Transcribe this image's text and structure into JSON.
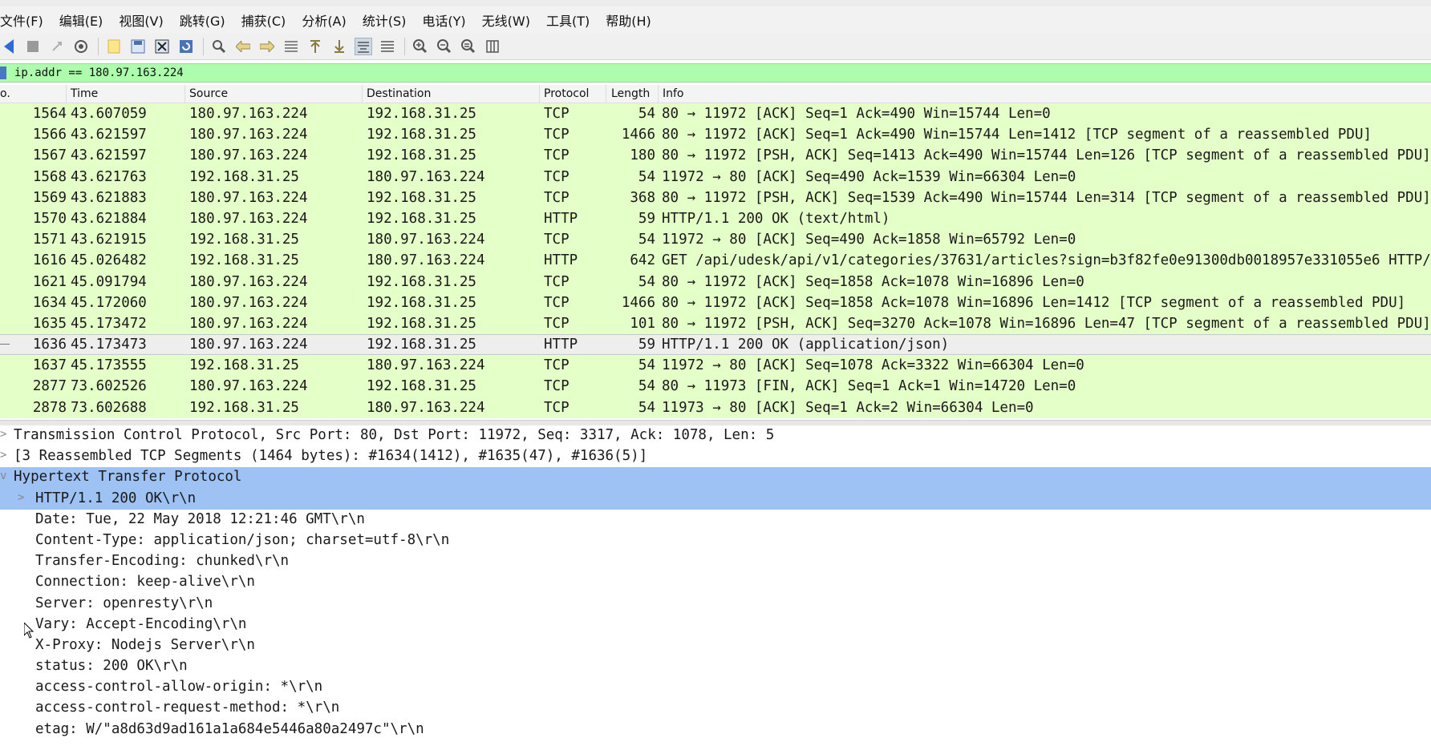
{
  "menubar": {
    "items": [
      {
        "label": "文件(F)"
      },
      {
        "label": "编辑(E)"
      },
      {
        "label": "视图(V)"
      },
      {
        "label": "跳转(G)"
      },
      {
        "label": "捕获(C)"
      },
      {
        "label": "分析(A)"
      },
      {
        "label": "统计(S)"
      },
      {
        "label": "电话(Y)"
      },
      {
        "label": "无线(W)"
      },
      {
        "label": "工具(T)"
      },
      {
        "label": "帮助(H)"
      }
    ]
  },
  "toolbar": {
    "icons": [
      "start-capture-icon",
      "stop-capture-icon",
      "restart-capture-icon",
      "capture-options-icon",
      "open-file-icon",
      "save-file-icon",
      "close-file-icon",
      "reload-file-icon",
      "find-packet-icon",
      "go-back-icon",
      "go-forward-icon",
      "go-to-packet-icon",
      "go-first-icon",
      "go-last-icon",
      "autoscroll-icon",
      "colorize-icon",
      "zoom-in-icon",
      "zoom-out-icon",
      "zoom-normal-icon",
      "resize-columns-icon"
    ]
  },
  "filter": {
    "value": "ip.addr == 180.97.163.224",
    "color": "#aefcae"
  },
  "packet_list": {
    "headers": {
      "no": "o.",
      "time": "Time",
      "source": "Source",
      "destination": "Destination",
      "protocol": "Protocol",
      "length": "Length",
      "info": "Info"
    },
    "row_color": "#e4ffc7",
    "rows": [
      {
        "no": "1564",
        "time": "43.607059",
        "src": "180.97.163.224",
        "dst": "192.168.31.25",
        "proto": "TCP",
        "len": "54",
        "info": "80 → 11972 [ACK] Seq=1 Ack=490 Win=15744 Len=0"
      },
      {
        "no": "1566",
        "time": "43.621597",
        "src": "180.97.163.224",
        "dst": "192.168.31.25",
        "proto": "TCP",
        "len": "1466",
        "info": "80 → 11972 [ACK] Seq=1 Ack=490 Win=15744 Len=1412 [TCP segment of a reassembled PDU]"
      },
      {
        "no": "1567",
        "time": "43.621597",
        "src": "180.97.163.224",
        "dst": "192.168.31.25",
        "proto": "TCP",
        "len": "180",
        "info": "80 → 11972 [PSH, ACK] Seq=1413 Ack=490 Win=15744 Len=126 [TCP segment of a reassembled PDU]"
      },
      {
        "no": "1568",
        "time": "43.621763",
        "src": "192.168.31.25",
        "dst": "180.97.163.224",
        "proto": "TCP",
        "len": "54",
        "info": "11972 → 80 [ACK] Seq=490 Ack=1539 Win=66304 Len=0"
      },
      {
        "no": "1569",
        "time": "43.621883",
        "src": "180.97.163.224",
        "dst": "192.168.31.25",
        "proto": "TCP",
        "len": "368",
        "info": "80 → 11972 [PSH, ACK] Seq=1539 Ack=490 Win=15744 Len=314 [TCP segment of a reassembled PDU]"
      },
      {
        "no": "1570",
        "time": "43.621884",
        "src": "180.97.163.224",
        "dst": "192.168.31.25",
        "proto": "HTTP",
        "len": "59",
        "info": "HTTP/1.1 200 OK  (text/html)"
      },
      {
        "no": "1571",
        "time": "43.621915",
        "src": "192.168.31.25",
        "dst": "180.97.163.224",
        "proto": "TCP",
        "len": "54",
        "info": "11972 → 80 [ACK] Seq=490 Ack=1858 Win=65792 Len=0"
      },
      {
        "no": "1616",
        "time": "45.026482",
        "src": "192.168.31.25",
        "dst": "180.97.163.224",
        "proto": "HTTP",
        "len": "642",
        "info": "GET /api/udesk/api/v1/categories/37631/articles?sign=b3f82fe0e91300db0018957e331055e6 HTTP/"
      },
      {
        "no": "1621",
        "time": "45.091794",
        "src": "180.97.163.224",
        "dst": "192.168.31.25",
        "proto": "TCP",
        "len": "54",
        "info": "80 → 11972 [ACK] Seq=1858 Ack=1078 Win=16896 Len=0"
      },
      {
        "no": "1634",
        "time": "45.172060",
        "src": "180.97.163.224",
        "dst": "192.168.31.25",
        "proto": "TCP",
        "len": "1466",
        "info": "80 → 11972 [ACK] Seq=1858 Ack=1078 Win=16896 Len=1412 [TCP segment of a reassembled PDU]"
      },
      {
        "no": "1635",
        "time": "45.173472",
        "src": "180.97.163.224",
        "dst": "192.168.31.25",
        "proto": "TCP",
        "len": "101",
        "info": "80 → 11972 [PSH, ACK] Seq=3270 Ack=1078 Win=16896 Len=47 [TCP segment of a reassembled PDU]"
      },
      {
        "no": "1636",
        "time": "45.173473",
        "src": "180.97.163.224",
        "dst": "192.168.31.25",
        "proto": "HTTP",
        "len": "59",
        "info": "HTTP/1.1 200 OK  (application/json)",
        "selected": true
      },
      {
        "no": "1637",
        "time": "45.173555",
        "src": "192.168.31.25",
        "dst": "180.97.163.224",
        "proto": "TCP",
        "len": "54",
        "info": "11972 → 80 [ACK] Seq=1078 Ack=3322 Win=66304 Len=0"
      },
      {
        "no": "2877",
        "time": "73.602526",
        "src": "180.97.163.224",
        "dst": "192.168.31.25",
        "proto": "TCP",
        "len": "54",
        "info": "80 → 11973 [FIN, ACK] Seq=1 Ack=1 Win=14720 Len=0"
      },
      {
        "no": "2878",
        "time": "73.602688",
        "src": "192.168.31.25",
        "dst": "180.97.163.224",
        "proto": "TCP",
        "len": "54",
        "info": "11973 → 80 [ACK] Seq=1 Ack=2 Win=66304 Len=0"
      }
    ]
  },
  "details": {
    "selected_color": "#9ec2f4",
    "rows": [
      {
        "level": 0,
        "arrow": ">",
        "text": "Transmission Control Protocol, Src Port: 80, Dst Port: 11972, Seq: 3317, Ack: 1078, Len: 5"
      },
      {
        "level": 0,
        "arrow": ">",
        "text": "[3 Reassembled TCP Segments (1464 bytes): #1634(1412), #1635(47), #1636(5)]"
      },
      {
        "level": 0,
        "arrow": "v",
        "text": "Hypertext Transfer Protocol",
        "selected": true
      },
      {
        "level": 1,
        "arrow": ">",
        "text": "HTTP/1.1 200 OK\\r\\n",
        "selected": true
      },
      {
        "level": 1,
        "arrow": "",
        "text": "Date: Tue, 22 May 2018 12:21:46 GMT\\r\\n"
      },
      {
        "level": 1,
        "arrow": "",
        "text": "Content-Type: application/json; charset=utf-8\\r\\n"
      },
      {
        "level": 1,
        "arrow": "",
        "text": "Transfer-Encoding: chunked\\r\\n"
      },
      {
        "level": 1,
        "arrow": "",
        "text": "Connection: keep-alive\\r\\n"
      },
      {
        "level": 1,
        "arrow": "",
        "text": "Server: openresty\\r\\n"
      },
      {
        "level": 1,
        "arrow": "",
        "text": "Vary: Accept-Encoding\\r\\n"
      },
      {
        "level": 1,
        "arrow": "",
        "text": "X-Proxy: Nodejs Server\\r\\n"
      },
      {
        "level": 1,
        "arrow": "",
        "text": "status: 200 OK\\r\\n"
      },
      {
        "level": 1,
        "arrow": "",
        "text": "access-control-allow-origin: *\\r\\n"
      },
      {
        "level": 1,
        "arrow": "",
        "text": "access-control-request-method: *\\r\\n"
      },
      {
        "level": 1,
        "arrow": "",
        "text": "etag: W/\"a8d63d9ad161a1a684e5446a80a2497c\"\\r\\n"
      }
    ]
  }
}
